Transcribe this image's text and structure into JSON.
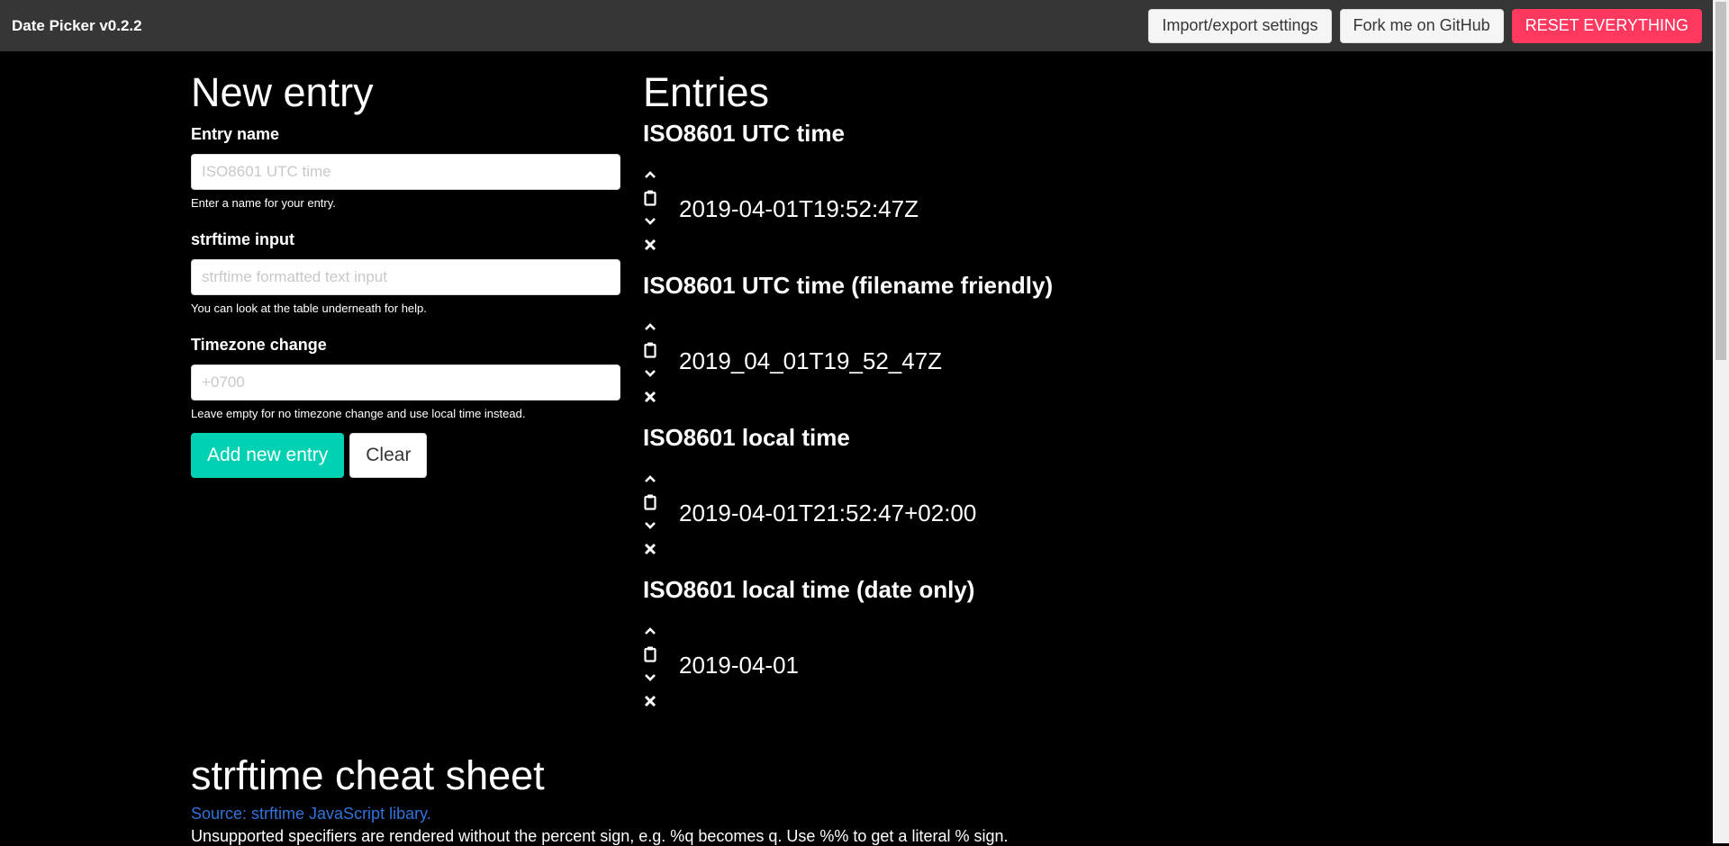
{
  "navbar": {
    "brand": "Date Picker v0.2.2",
    "import_export": "Import/export settings",
    "github": "Fork me on GitHub",
    "reset": "RESET EVERYTHING",
    "reset_color": "#ff3860"
  },
  "new_entry": {
    "title": "New entry",
    "name_label": "Entry name",
    "name_placeholder": "ISO8601 UTC time",
    "name_help": "Enter a name for your entry.",
    "strftime_label": "strftime input",
    "strftime_placeholder": "strftime formatted text input",
    "strftime_help": "You can look at the table underneath for help.",
    "tz_label": "Timezone change",
    "tz_placeholder": "+0700",
    "tz_help": "Leave empty for no timezone change and use local time instead.",
    "add_button": "Add new entry",
    "clear_button": "Clear",
    "accent_color": "#00d1b2"
  },
  "entries": {
    "title": "Entries",
    "items": [
      {
        "name": "ISO8601 UTC time",
        "value": "2019-04-01T19:52:47Z"
      },
      {
        "name": "ISO8601 UTC time (filename friendly)",
        "value": "2019_04_01T19_52_47Z"
      },
      {
        "name": "ISO8601 local time",
        "value": "2019-04-01T21:52:47+02:00"
      },
      {
        "name": "ISO8601 local time (date only)",
        "value": "2019-04-01"
      }
    ],
    "controls": [
      "chevron-up-icon",
      "clipboard-icon",
      "chevron-down-icon",
      "close-icon"
    ]
  },
  "cheat_sheet": {
    "title": "strftime cheat sheet",
    "source_link": "Source: strftime JavaScript libary.",
    "note": "Unsupported specifiers are rendered without the percent sign, e.g. %q becomes q. Use %% to get a literal % sign.",
    "link_color": "#3273dc"
  }
}
